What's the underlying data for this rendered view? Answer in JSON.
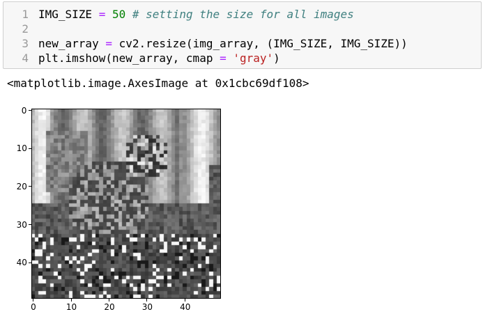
{
  "input_cell": {
    "lines": [
      {
        "number": "1",
        "parts": [
          {
            "text": "IMG_SIZE ",
            "cls": ""
          },
          {
            "text": "=",
            "cls": "tok-op"
          },
          {
            "text": " ",
            "cls": ""
          },
          {
            "text": "50",
            "cls": "tok-num"
          },
          {
            "text": " ",
            "cls": ""
          },
          {
            "text": "# setting the size for all images",
            "cls": "tok-comment"
          }
        ]
      },
      {
        "number": "2",
        "parts": []
      },
      {
        "number": "3",
        "parts": [
          {
            "text": "new_array ",
            "cls": ""
          },
          {
            "text": "=",
            "cls": "tok-op"
          },
          {
            "text": " cv2.resize(img_array, (IMG_SIZE, IMG_SIZE))",
            "cls": ""
          }
        ]
      },
      {
        "number": "4",
        "parts": [
          {
            "text": "plt.imshow(new_array, cmap ",
            "cls": ""
          },
          {
            "text": "=",
            "cls": "tok-op"
          },
          {
            "text": " ",
            "cls": ""
          },
          {
            "text": "'gray'",
            "cls": "tok-str"
          },
          {
            "text": ")",
            "cls": ""
          }
        ]
      }
    ]
  },
  "output": {
    "repr": "<matplotlib.image.AxesImage at 0x1cbc69df108>"
  },
  "chart_data": {
    "type": "heatmap",
    "colormap": "gray",
    "shape": [
      50,
      50
    ],
    "xticks": [
      "0",
      "10",
      "20",
      "30",
      "40"
    ],
    "yticks": [
      "0",
      "10",
      "20",
      "30",
      "40"
    ],
    "xlim": [
      -0.5,
      49.5
    ],
    "ylim": [
      49.5,
      -0.5
    ],
    "grid": false,
    "title": "",
    "xlabel": "",
    "ylabel": ""
  }
}
